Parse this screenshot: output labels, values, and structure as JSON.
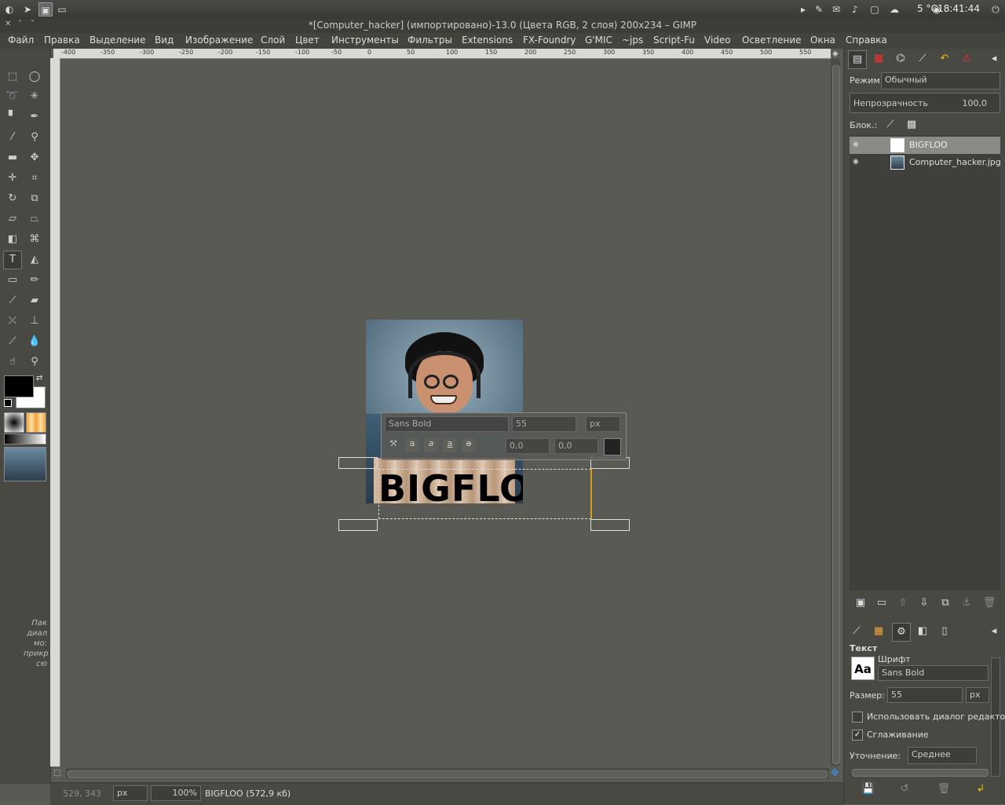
{
  "system": {
    "temperature": "5 °C",
    "clock": "18:41:44"
  },
  "window": {
    "title": "*[Computer_hacker] (импортировано)-13.0 (Цвета RGB, 2 слоя) 200x234 – GIMP"
  },
  "menu": [
    "Файл",
    "Правка",
    "Выделение",
    "Вид",
    "Изображение",
    "Слой",
    "Цвет",
    "Инструменты",
    "Фильтры",
    "Extensions",
    "FX-Foundry",
    "G'MIC",
    "~jps",
    "Script-Fu",
    "Video",
    "Осветление",
    "Окна",
    "Справка"
  ],
  "rulers": {
    "h_labels": [
      "-400",
      "-350",
      "-300",
      "-250",
      "-200",
      "-150",
      "-100",
      "-50",
      "0",
      "50",
      "100",
      "150",
      "200",
      "250",
      "300",
      "350",
      "400",
      "450",
      "500",
      "550"
    ]
  },
  "toolbox": {
    "side_note": [
      "Пак",
      "диал",
      "мо:",
      "прикр",
      "сю"
    ]
  },
  "canvas": {
    "text_on_image": "BIGFLO",
    "text_overlay": {
      "font": "Sans Bold",
      "size": "55",
      "unit": "px",
      "baseline": "0,0",
      "kerning": "0,0",
      "style_buttons": [
        "a",
        "a",
        "a",
        "a"
      ]
    }
  },
  "statusbar": {
    "coords": "529, 343",
    "unit": "px",
    "zoom": "100%",
    "info": "BIGFLOO (572,9 кб)"
  },
  "layers_dock": {
    "mode_label": "Режим:",
    "mode_value": "Обычный",
    "opacity_label": "Непрозрачность",
    "opacity_value": "100,0",
    "lock_label": "Блок.:",
    "layers": [
      {
        "name": "BIGFLOO",
        "selected": true
      },
      {
        "name": "Computer_hacker.jpg",
        "selected": false
      }
    ]
  },
  "tool_options": {
    "title": "Текст",
    "font_label": "Шрифт",
    "font_value": "Sans Bold",
    "font_preview": "Aa",
    "size_label": "Размер:",
    "size_value": "55",
    "size_unit": "px",
    "use_editor_label": "Использовать диалог редакто",
    "use_editor_checked": false,
    "antialias_label": "Сглаживание",
    "antialias_checked": true,
    "hinting_label": "Уточнение:",
    "hinting_value": "Среднее"
  }
}
